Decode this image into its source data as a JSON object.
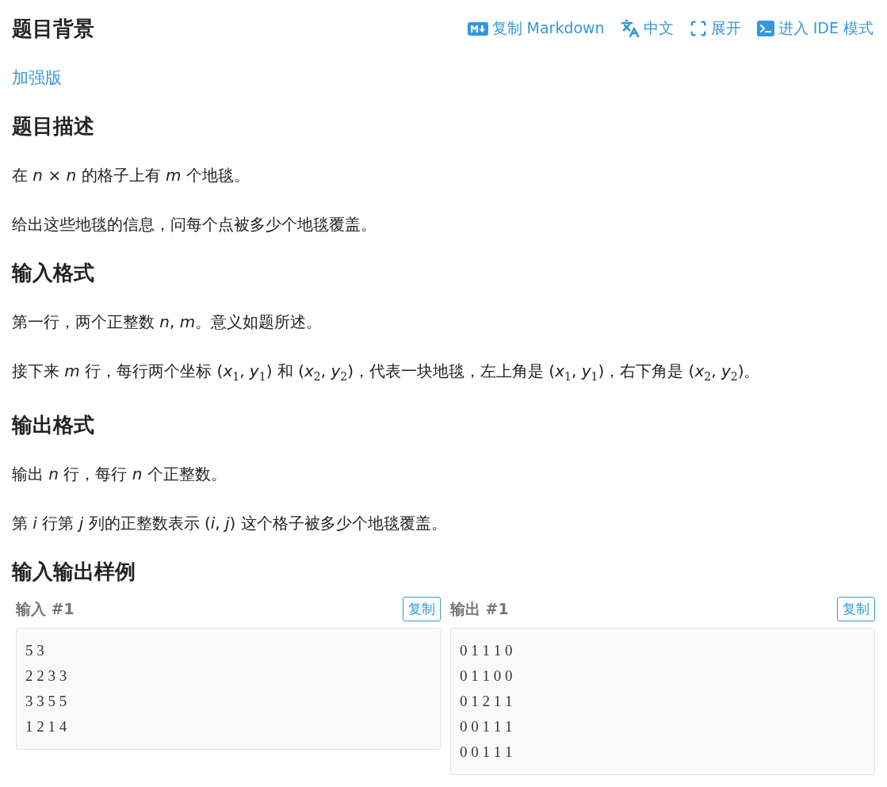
{
  "toolbar": [
    {
      "kind": "markdown",
      "label": "复制 Markdown"
    },
    {
      "kind": "translate",
      "label": "中文"
    },
    {
      "kind": "expand",
      "label": "展开"
    },
    {
      "kind": "ide",
      "label": "进入 IDE 模式"
    }
  ],
  "sections": [
    {
      "heading": "题目背景",
      "blocks": [
        {
          "kind": "link",
          "text": "加强版"
        }
      ]
    },
    {
      "heading": "题目描述",
      "blocks": [
        {
          "kind": "text",
          "text": "在 *n* × *n* 的格子上有 *m* 个地毯。"
        },
        {
          "kind": "text",
          "text": "给出这些地毯的信息，问每个点被多少个地毯覆盖。"
        }
      ]
    },
    {
      "heading": "输入格式",
      "blocks": [
        {
          "kind": "text",
          "text": "第一行，两个正整数 *n*, *m*。意义如题所述。"
        },
        {
          "kind": "text",
          "text": "接下来 *m* 行，每行两个坐标 (*x*$_{1}$, *y*$_{1}$) 和 (*x*$_{2}$, *y*$_{2}$)，代表一块地毯，左上角是 (*x*$_{1}$, *y*$_{1}$)，右下角是 (*x*$_{2}$, *y*$_{2}$)。"
        }
      ]
    },
    {
      "heading": "输出格式",
      "blocks": [
        {
          "kind": "text",
          "text": "输出 *n* 行，每行 *n* 个正整数。"
        },
        {
          "kind": "text",
          "text": "第 *i* 行第 *j* 列的正整数表示 (*i*, *j*) 这个格子被多少个地毯覆盖。"
        }
      ]
    }
  ],
  "sample_section": {
    "heading": "输入输出样例",
    "samples": [
      {
        "title": "输入 #1",
        "copy": "复制",
        "lines": [
          "5 3",
          "2 2 3 3",
          "3 3 5 5",
          "1 2 1 4"
        ]
      },
      {
        "title": "输出 #1",
        "copy": "复制",
        "lines": [
          "0 1 1 1 0",
          "0 1 1 0 0",
          "0 1 2 1 1",
          "0 0 1 1 1",
          "0 0 1 1 1"
        ]
      }
    ]
  }
}
